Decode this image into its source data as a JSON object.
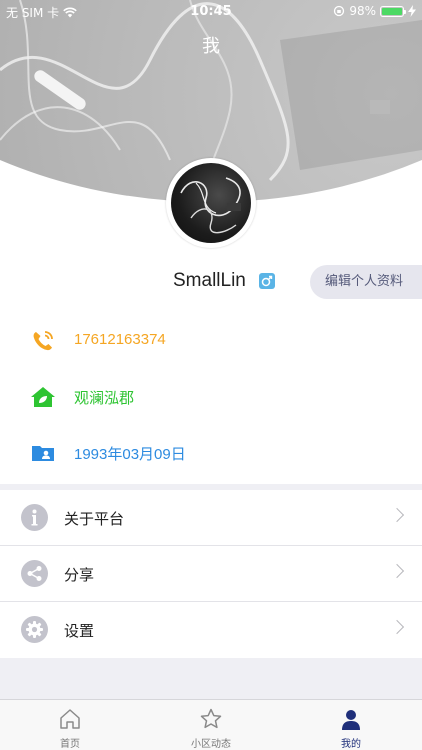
{
  "status_bar": {
    "carrier": "无 SIM 卡",
    "time": "10:45",
    "battery": "98%",
    "battery_level": 0.98
  },
  "header": {
    "title": "我"
  },
  "profile": {
    "username": "SmallLin",
    "gender_icon": "male-icon",
    "edit_label": "编辑个人资料",
    "phone": "17612163374",
    "community": "观澜泓郡",
    "birthday": "1993年03月09日"
  },
  "colors": {
    "phone": "#f5a623",
    "community": "#2ec432",
    "birthday": "#2d8be0",
    "tab_active": "#1f2f7a"
  },
  "menu": {
    "items": [
      {
        "label": "关于平台",
        "icon": "info-icon"
      },
      {
        "label": "分享",
        "icon": "share-icon"
      },
      {
        "label": "设置",
        "icon": "gear-icon"
      }
    ]
  },
  "tabs": [
    {
      "label": "首页",
      "icon": "home-icon",
      "active": false
    },
    {
      "label": "小区动态",
      "icon": "star-icon",
      "active": false
    },
    {
      "label": "我的",
      "icon": "person-icon",
      "active": true
    }
  ]
}
